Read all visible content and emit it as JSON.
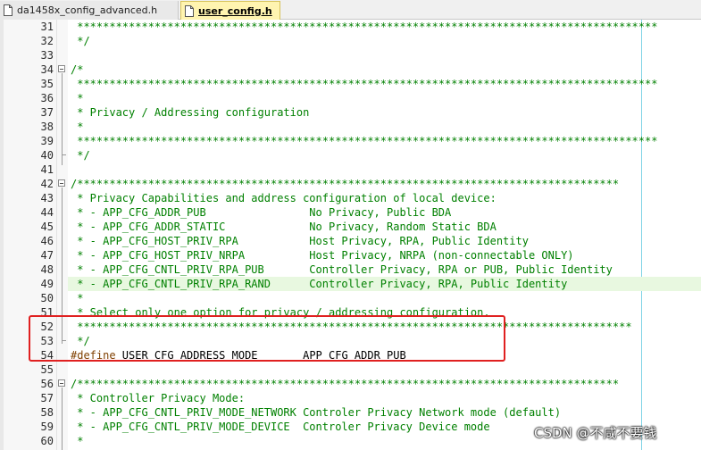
{
  "tabs": [
    {
      "label": "da1458x_config_advanced.h",
      "active": false
    },
    {
      "label": "user_config.h",
      "active": true
    }
  ],
  "colors": {
    "comment": "#008000",
    "preprocessor": "#804000",
    "identifier": "#000000",
    "highlight_line": "#e8f8e0",
    "annotation_box": "#e02020"
  },
  "lines": [
    {
      "num": "31",
      "parts": [
        {
          "t": " ******************************************************************************************",
          "c": "comment"
        }
      ]
    },
    {
      "num": "32",
      "parts": [
        {
          "t": " */",
          "c": "comment"
        }
      ]
    },
    {
      "num": "33",
      "parts": []
    },
    {
      "num": "34",
      "parts": [
        {
          "t": "/*",
          "c": "comment"
        }
      ]
    },
    {
      "num": "35",
      "parts": [
        {
          "t": " ******************************************************************************************",
          "c": "comment"
        }
      ]
    },
    {
      "num": "36",
      "parts": [
        {
          "t": " *",
          "c": "comment"
        }
      ]
    },
    {
      "num": "37",
      "parts": [
        {
          "t": " * Privacy / Addressing configuration",
          "c": "comment"
        }
      ]
    },
    {
      "num": "38",
      "parts": [
        {
          "t": " *",
          "c": "comment"
        }
      ]
    },
    {
      "num": "39",
      "parts": [
        {
          "t": " ******************************************************************************************",
          "c": "comment"
        }
      ]
    },
    {
      "num": "40",
      "parts": [
        {
          "t": " */",
          "c": "comment"
        }
      ]
    },
    {
      "num": "41",
      "parts": []
    },
    {
      "num": "42",
      "parts": [
        {
          "t": "/************************************************************************************",
          "c": "comment"
        }
      ]
    },
    {
      "num": "43",
      "parts": [
        {
          "t": " * Privacy Capabilities and address configuration of local device:",
          "c": "comment"
        }
      ]
    },
    {
      "num": "44",
      "parts": [
        {
          "t": " * - APP_CFG_ADDR_PUB                No Privacy, Public BDA",
          "c": "comment"
        }
      ]
    },
    {
      "num": "45",
      "parts": [
        {
          "t": " * - APP_CFG_ADDR_STATIC             No Privacy, Random Static BDA",
          "c": "comment"
        }
      ]
    },
    {
      "num": "46",
      "parts": [
        {
          "t": " * - APP_CFG_HOST_PRIV_RPA           Host Privacy, RPA, Public Identity",
          "c": "comment"
        }
      ]
    },
    {
      "num": "47",
      "parts": [
        {
          "t": " * - APP_CFG_HOST_PRIV_NRPA          Host Privacy, NRPA (non-connectable ONLY)",
          "c": "comment"
        }
      ]
    },
    {
      "num": "48",
      "parts": [
        {
          "t": " * - APP_CFG_CNTL_PRIV_RPA_PUB       Controller Privacy, RPA or PUB, Public Identity",
          "c": "comment"
        }
      ]
    },
    {
      "num": "49",
      "highlight": true,
      "parts": [
        {
          "t": " * - APP_CFG_CNTL_PRIV_RPA_RAND      Controller Privacy, RPA, Public Identity",
          "c": "comment"
        }
      ]
    },
    {
      "num": "50",
      "parts": [
        {
          "t": " *",
          "c": "comment"
        }
      ]
    },
    {
      "num": "51",
      "parts": [
        {
          "t": " * Select only one option for privacy / addressing configuration.",
          "c": "comment"
        }
      ]
    },
    {
      "num": "52",
      "parts": [
        {
          "t": " **************************************************************************************",
          "c": "comment"
        }
      ]
    },
    {
      "num": "53",
      "parts": [
        {
          "t": " */",
          "c": "comment"
        }
      ]
    },
    {
      "num": "54",
      "parts": [
        {
          "t": "#define",
          "c": "kw"
        },
        {
          "t": " USER_CFG_ADDRESS_MODE       APP_CFG_ADDR_PUB",
          "c": "ident"
        }
      ]
    },
    {
      "num": "55",
      "parts": []
    },
    {
      "num": "56",
      "parts": [
        {
          "t": "/************************************************************************************",
          "c": "comment"
        }
      ]
    },
    {
      "num": "57",
      "parts": [
        {
          "t": " * Controller Privacy Mode:",
          "c": "comment"
        }
      ]
    },
    {
      "num": "58",
      "parts": [
        {
          "t": " * - APP_CFG_CNTL_PRIV_MODE_NETWORK Controler Privacy Network mode (default)",
          "c": "comment"
        }
      ]
    },
    {
      "num": "59",
      "parts": [
        {
          "t": " * - APP_CFG_CNTL_PRIV_MODE_DEVICE  Controler Privacy Device mode",
          "c": "comment"
        }
      ]
    },
    {
      "num": "60",
      "parts": [
        {
          "t": " *",
          "c": "comment"
        }
      ]
    }
  ],
  "watermark": "CSDN @不咸不要钱"
}
